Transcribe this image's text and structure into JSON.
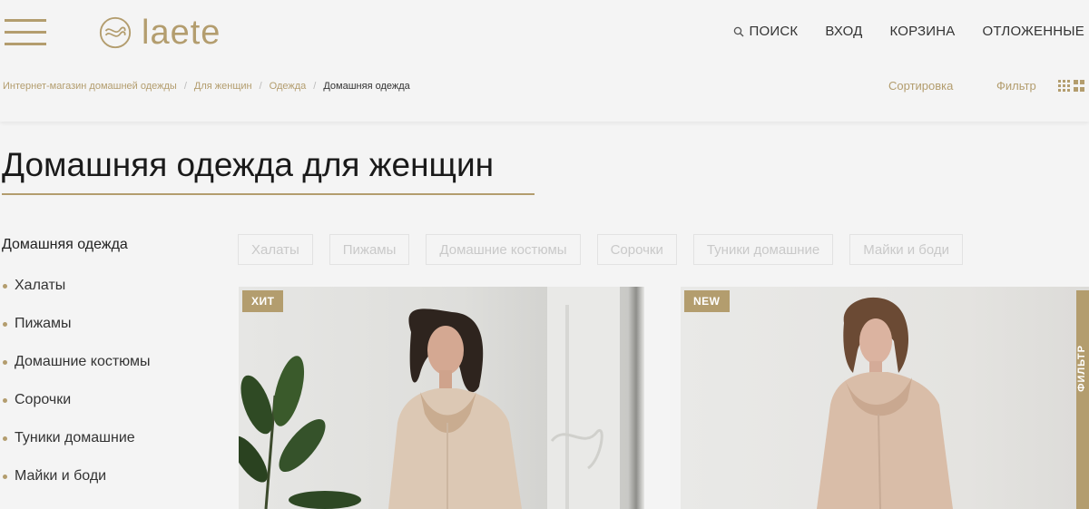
{
  "header": {
    "logo_text": "laete",
    "nav": {
      "search": "ПОИСК",
      "login": "ВХОД",
      "cart": "КОРЗИНА",
      "wishlist": "ОТЛОЖЕННЫЕ"
    }
  },
  "breadcrumb": {
    "items": [
      "Интернет-магазин домашней одежды",
      "Для женщин",
      "Одежда"
    ],
    "current": "Домашняя одежда",
    "separator": "/"
  },
  "toolbar": {
    "sort_label": "Сортировка",
    "filter_label": "Фильтр"
  },
  "page": {
    "title": "Домашняя одежда для женщин"
  },
  "sidebar": {
    "heading": "Домашняя одежда",
    "items": [
      "Халаты",
      "Пижамы",
      "Домашние костюмы",
      "Сорочки",
      "Туники домашние",
      "Майки и боди"
    ]
  },
  "tags": [
    "Халаты",
    "Пижамы",
    "Домашние костюмы",
    "Сорочки",
    "Туники домашние",
    "Майки и боди"
  ],
  "products": [
    {
      "badge": "ХИТ"
    },
    {
      "badge": "NEW"
    }
  ],
  "side_filter": {
    "label": "ФИЛЬТР"
  },
  "colors": {
    "accent": "#b39d6e",
    "background": "#f4f4f4",
    "text": "#222222"
  }
}
